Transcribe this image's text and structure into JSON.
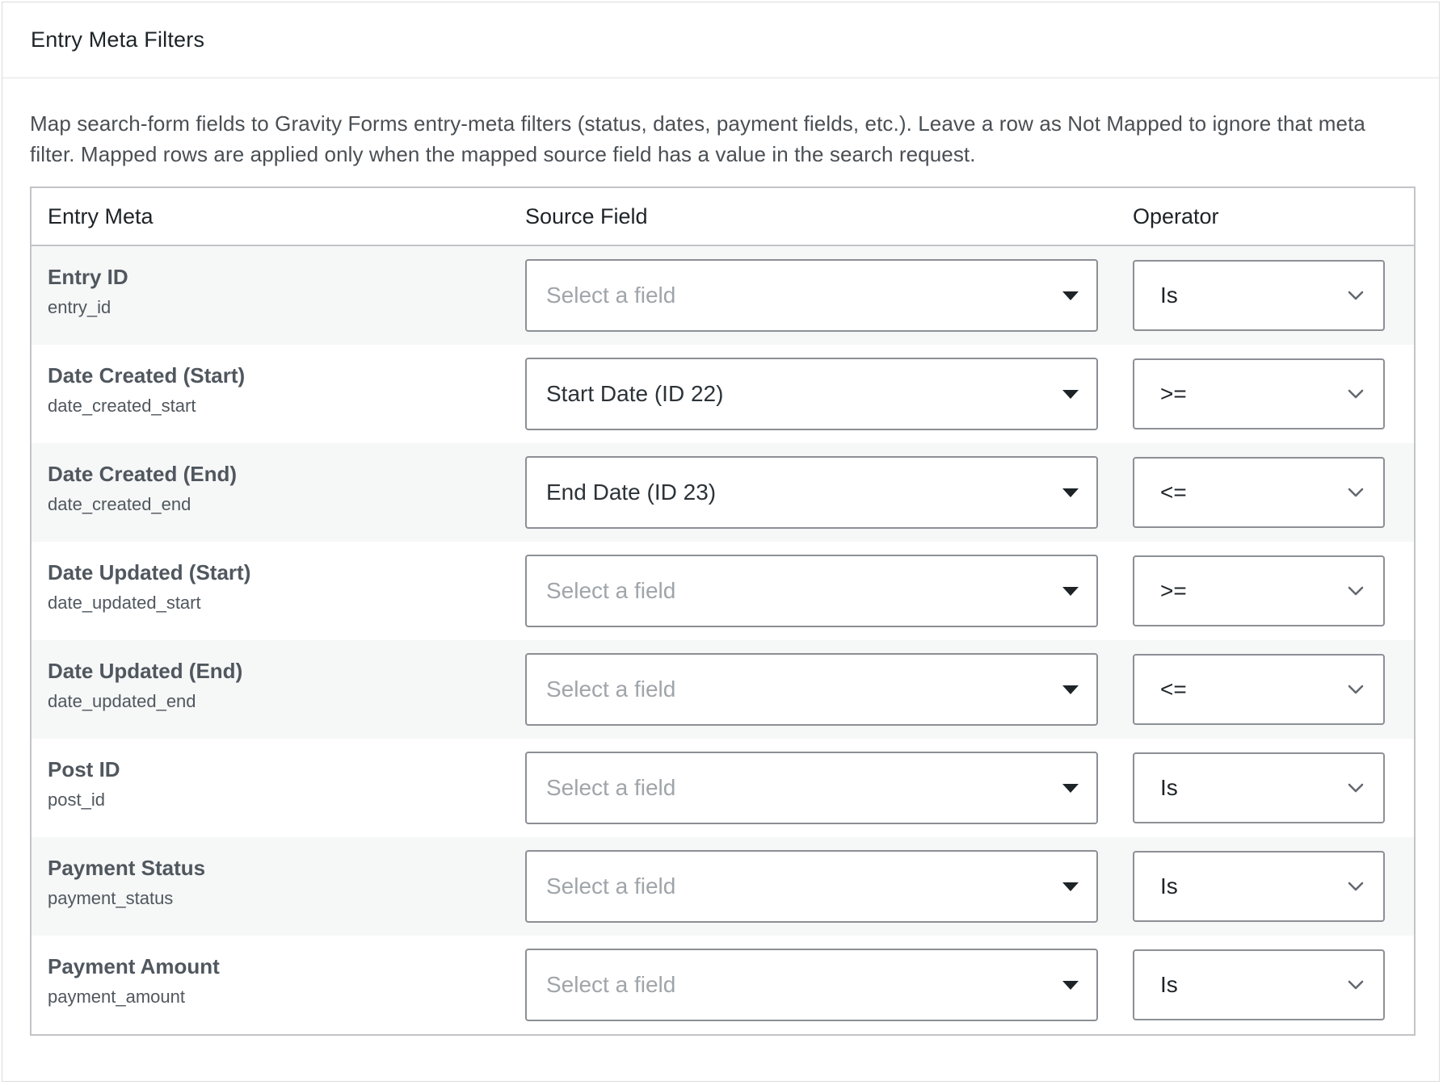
{
  "panel": {
    "title": "Entry Meta Filters",
    "description": "Map search-form fields to Gravity Forms entry-meta filters (status, dates, payment fields, etc.). Leave a row as Not Mapped to ignore that meta filter. Mapped rows are applied only when the mapped source field has a value in the search request."
  },
  "table": {
    "headers": {
      "entry_meta": "Entry Meta",
      "source_field": "Source Field",
      "operator": "Operator"
    },
    "rows": [
      {
        "label": "Entry ID",
        "key": "entry_id",
        "source": "",
        "source_placeholder": "Select a field",
        "operator": "Is"
      },
      {
        "label": "Date Created (Start)",
        "key": "date_created_start",
        "source": "Start Date (ID 22)",
        "source_placeholder": "",
        "operator": ">="
      },
      {
        "label": "Date Created (End)",
        "key": "date_created_end",
        "source": "End Date (ID 23)",
        "source_placeholder": "",
        "operator": "<="
      },
      {
        "label": "Date Updated (Start)",
        "key": "date_updated_start",
        "source": "",
        "source_placeholder": "Select a field",
        "operator": ">="
      },
      {
        "label": "Date Updated (End)",
        "key": "date_updated_end",
        "source": "",
        "source_placeholder": "Select a field",
        "operator": "<="
      },
      {
        "label": "Post ID",
        "key": "post_id",
        "source": "",
        "source_placeholder": "Select a field",
        "operator": "Is"
      },
      {
        "label": "Payment Status",
        "key": "payment_status",
        "source": "",
        "source_placeholder": "Select a field",
        "operator": "Is"
      },
      {
        "label": "Payment Amount",
        "key": "payment_amount",
        "source": "",
        "source_placeholder": "Select a field",
        "operator": "Is"
      }
    ]
  },
  "icons": {
    "source_caret": "caret-down-icon",
    "operator_chevron": "chevron-down-icon"
  },
  "colors": {
    "border": "#c3c4c7",
    "input_border": "#8c8f94",
    "placeholder": "#a0a5aa",
    "row_shade": "#f6f7f7"
  }
}
